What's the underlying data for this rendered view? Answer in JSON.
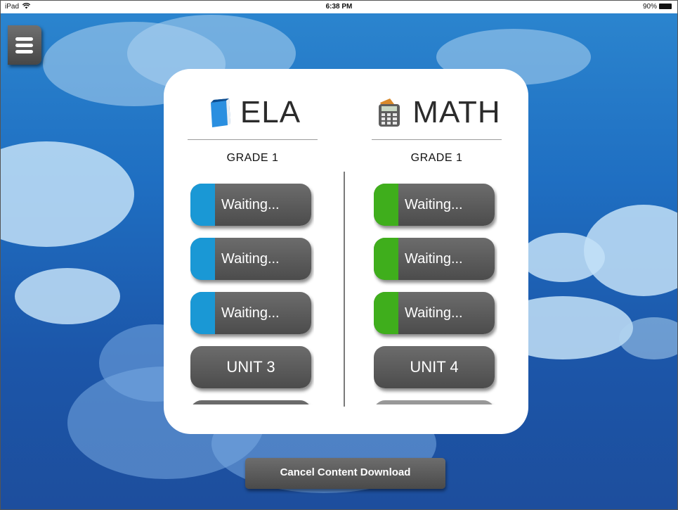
{
  "status_bar": {
    "device": "iPad",
    "time": "6:38 PM",
    "battery": "90%"
  },
  "subjects": [
    {
      "name": "ELA",
      "grade": "GRADE 1",
      "accent_color": "#1a98d5",
      "units": [
        {
          "label": "Waiting...",
          "state": "downloading"
        },
        {
          "label": "Waiting...",
          "state": "downloading"
        },
        {
          "label": "Waiting...",
          "state": "downloading"
        },
        {
          "label": "UNIT 3",
          "state": "idle"
        }
      ]
    },
    {
      "name": "MATH",
      "grade": "GRADE 1",
      "accent_color": "#3fae1c",
      "units": [
        {
          "label": "Waiting...",
          "state": "downloading"
        },
        {
          "label": "Waiting...",
          "state": "downloading"
        },
        {
          "label": "Waiting...",
          "state": "downloading"
        },
        {
          "label": "UNIT 4",
          "state": "idle"
        }
      ]
    }
  ],
  "icons": {
    "menu": "hamburger-icon",
    "ela": "book-icon",
    "math": "calculator-icon",
    "wifi": "wifi-icon",
    "battery": "battery-icon"
  },
  "actions": {
    "cancel_label": "Cancel Content Download"
  }
}
